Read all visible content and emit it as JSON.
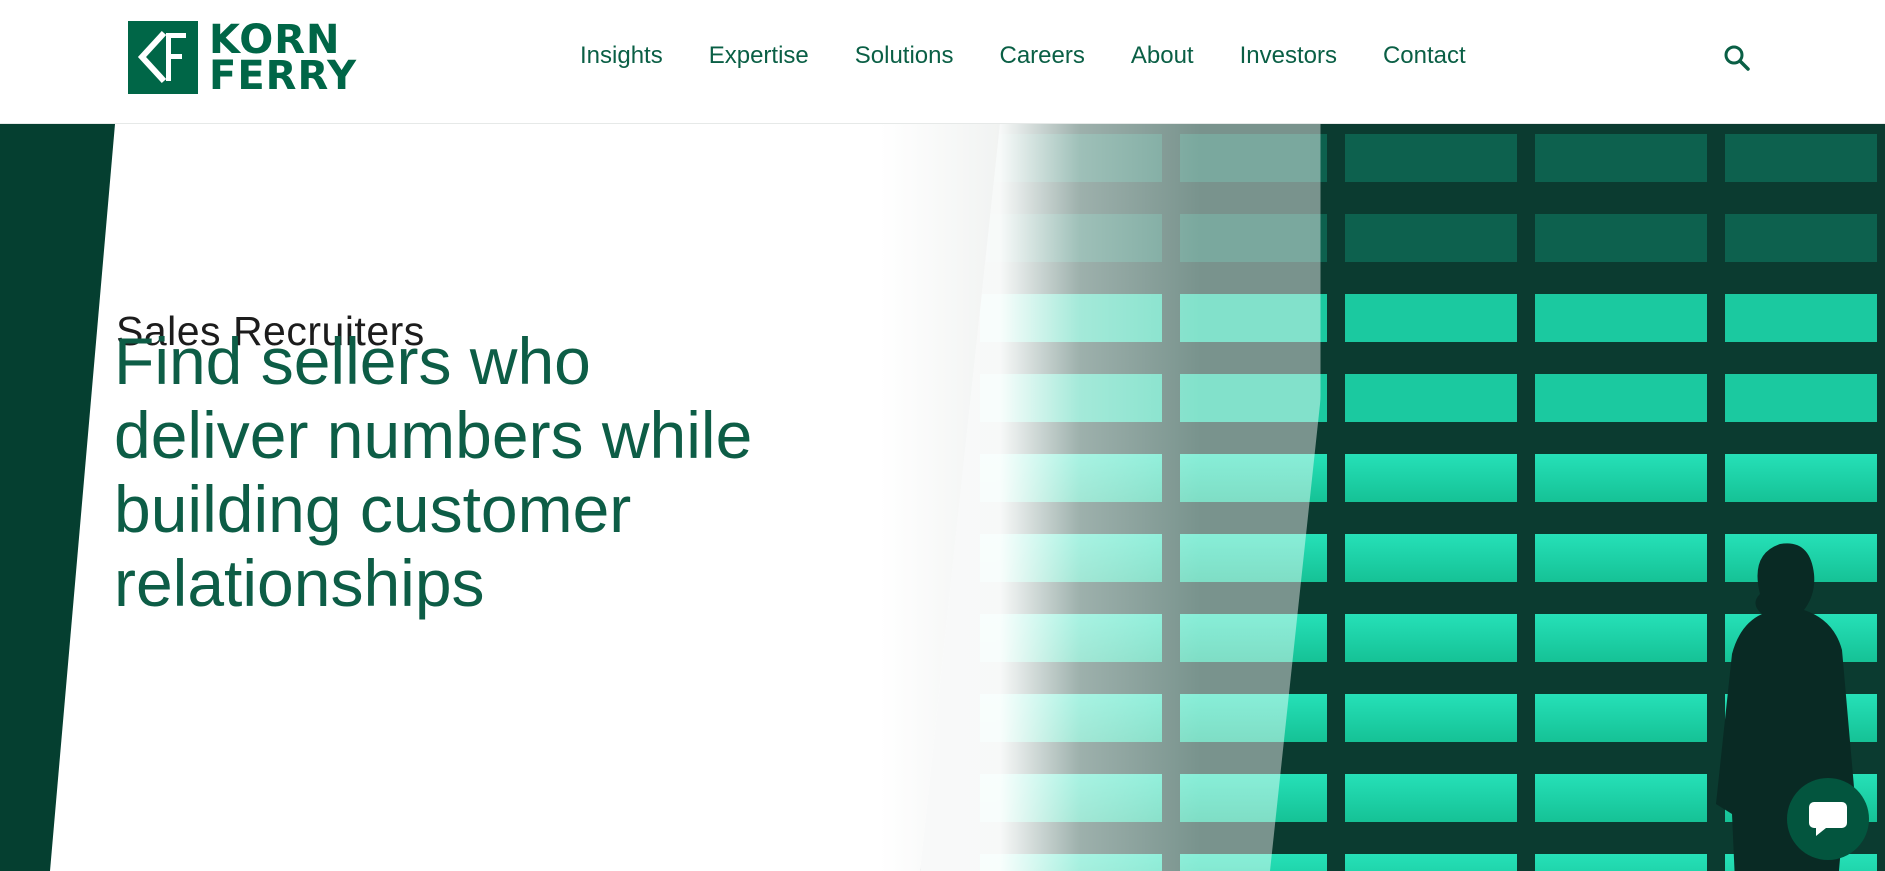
{
  "brand": {
    "name_line1": "KORN",
    "name_line2": "FERRY",
    "primary_color": "#006647",
    "dark_color": "#053f30",
    "accent_teal": "#1fe5b0"
  },
  "nav": {
    "items": [
      {
        "label": "Insights"
      },
      {
        "label": "Expertise"
      },
      {
        "label": "Solutions"
      },
      {
        "label": "Careers"
      },
      {
        "label": "About"
      },
      {
        "label": "Investors"
      },
      {
        "label": "Contact"
      }
    ],
    "search_icon": "search-icon"
  },
  "hero": {
    "eyebrow": "Sales Recruiters",
    "headline_lines": [
      "Find sellers who",
      "deliver numbers while",
      "building customer",
      "relationships"
    ]
  },
  "chat": {
    "icon": "chat-bubble-icon"
  }
}
